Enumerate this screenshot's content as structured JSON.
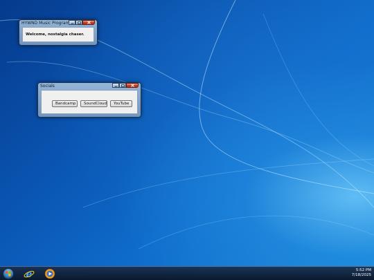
{
  "windows": {
    "main": {
      "title": "HYWND Music Program",
      "message": "Welcome, nostalgia chaser."
    },
    "socials": {
      "title": "Socials",
      "buttons": [
        "Bandcamp",
        "SoundCloud",
        "YouTube"
      ]
    }
  },
  "taskbar": {
    "items": [
      "start-orb-icon",
      "internet-explorer-icon",
      "media-player-icon"
    ],
    "clock": {
      "time": "5:52 PM",
      "date": "7/18/2025"
    }
  },
  "colors": {
    "close_button": "#c43b22",
    "desktop_blue": "#0a56b3"
  }
}
